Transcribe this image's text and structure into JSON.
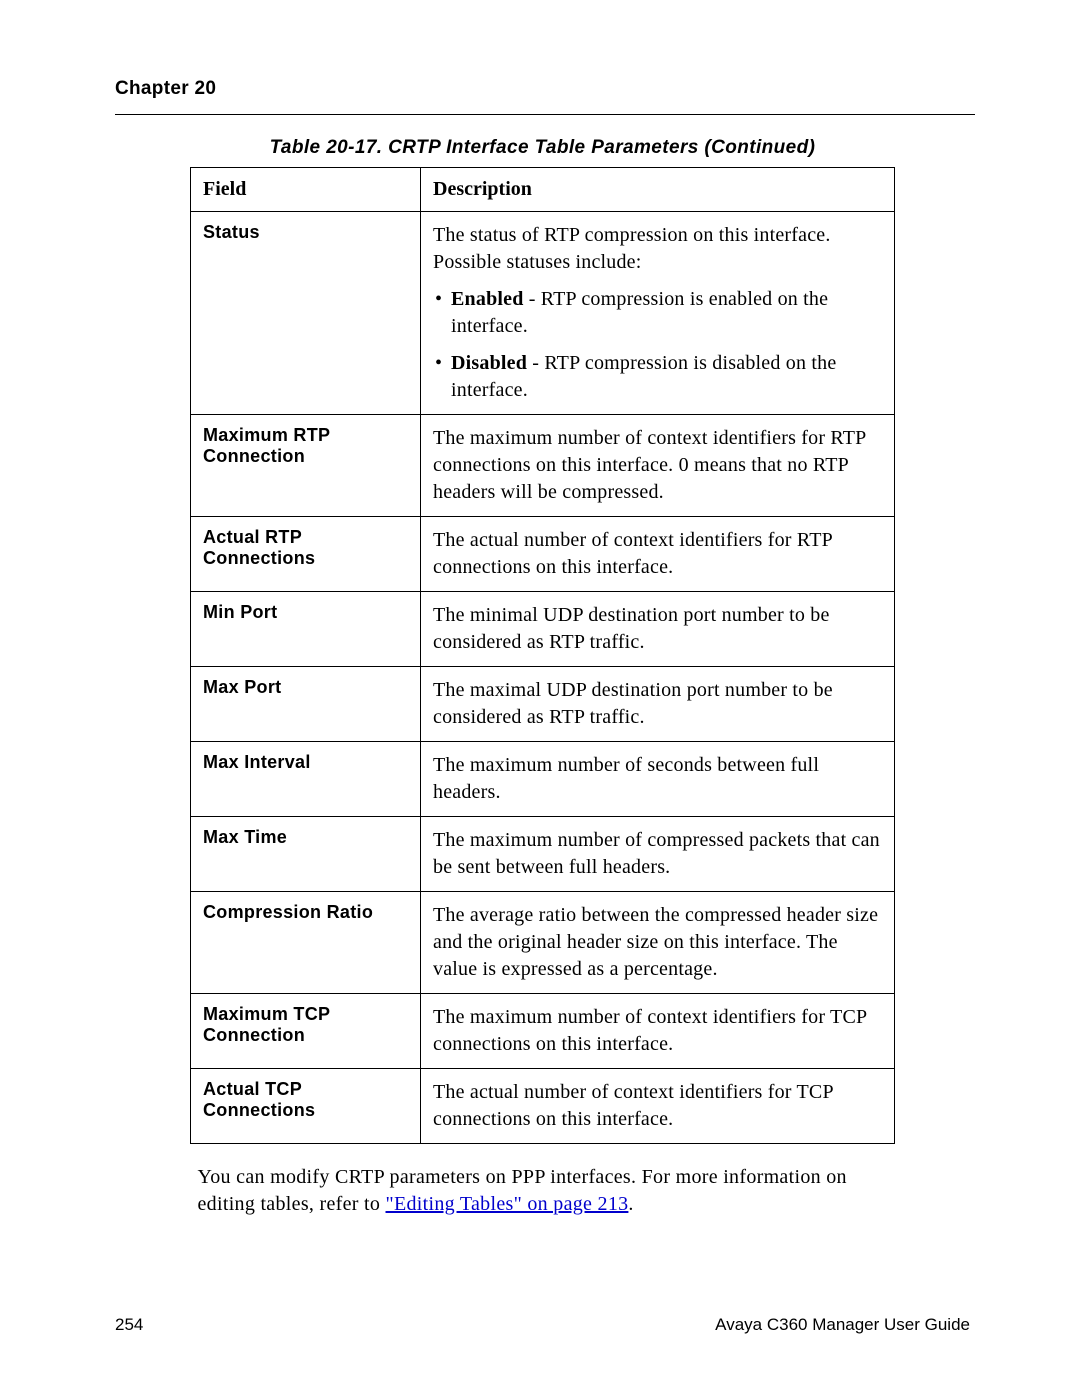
{
  "chapter": "Chapter 20",
  "caption": "Table 20-17.  CRTP Interface Table Parameters (Continued)",
  "columns": {
    "field": "Field",
    "description": "Description"
  },
  "rows": {
    "status": {
      "field": "Status",
      "intro": "The status of RTP compression on this interface. Possible statuses include:",
      "b1_label": "Enabled",
      "b1_rest": " - RTP compression is enabled on the interface.",
      "b2_label": "Disabled",
      "b2_rest": " - RTP compression is disabled on the interface."
    },
    "maxrtp": {
      "field": "Maximum RTP Connection",
      "desc": "The maximum number of context identifiers for RTP connections on this interface. 0 means that no RTP headers will be compressed."
    },
    "actualrtp": {
      "field": "Actual RTP Connections",
      "desc": "The actual number of context identifiers for RTP connections on this interface."
    },
    "minport": {
      "field": "Min Port",
      "desc": "The minimal UDP destination port number to be considered as RTP traffic."
    },
    "maxport": {
      "field": "Max Port",
      "desc": "The maximal UDP destination port number to be considered as RTP traffic."
    },
    "maxinterval": {
      "field": "Max Interval",
      "desc": "The maximum number of seconds between full headers."
    },
    "maxtime": {
      "field": "Max Time",
      "desc": "The maximum number of compressed packets that can be sent between full headers."
    },
    "compratio": {
      "field": "Compression Ratio",
      "desc": "The average ratio between the compressed header size and the original header size on this interface. The value is expressed as a percentage."
    },
    "maxtcp": {
      "field": "Maximum TCP Connection",
      "desc": "The maximum number of context identifiers for TCP connections on this interface."
    },
    "actualtcp": {
      "field": "Actual TCP Connections",
      "desc": "The actual number of context identifiers for TCP connections on this interface."
    }
  },
  "body": {
    "pre": "You can modify CRTP parameters on PPP interfaces. For more information on editing tables, refer to ",
    "link": "\"Editing Tables\" on page 213",
    "post": "."
  },
  "footer": {
    "page": "254",
    "guide": "Avaya C360 Manager User Guide"
  }
}
